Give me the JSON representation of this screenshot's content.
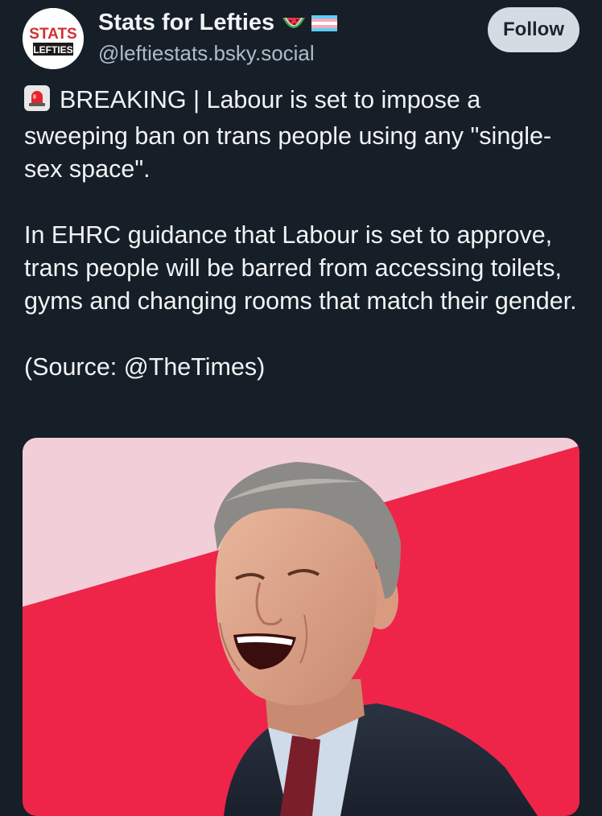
{
  "author": {
    "name": "Stats for Lefties",
    "handle": "@leftiestats.bsky.social",
    "avatar_text_top": "STATS",
    "avatar_text_bottom": "LEFTIES",
    "name_icons": [
      "watermelon-icon",
      "trans-flag-icon"
    ]
  },
  "actions": {
    "follow_label": "Follow"
  },
  "post": {
    "line1_label": "BREAKING | Labour is set to impose a sweeping ban on trans people using any \"single-sex space\".",
    "line2": "In EHRC guidance that Labour is set to approve, trans people will be barred from accessing toilets, gyms and changing rooms that match their gender.",
    "line3": "(Source: @TheTimes)",
    "leading_icon": "siren-icon"
  },
  "colors": {
    "background": "#161e27",
    "text": "#f1f3f5",
    "handle": "#aebbc9",
    "follow_bg": "#d4dbe2",
    "image_red": "#ef2449",
    "image_pink": "#f2cfd8"
  }
}
